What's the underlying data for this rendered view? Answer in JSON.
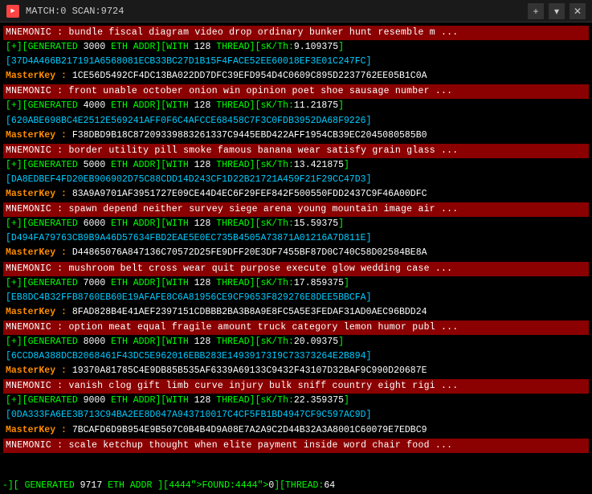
{
  "titleBar": {
    "icon": "►",
    "title": "MATCH:0 SCAN:9724",
    "closeBtn": "✕",
    "newTabBtn": "+",
    "dropdownBtn": "▾"
  },
  "blocks": [
    {
      "mnemonic": "MNEMONIC : bundle fiscal diagram video drop ordinary bunker hunt resemble m ...",
      "generated": "[+][GENERATED 3000 ETH ADDR][WITH 128 THREAD][sK/Th:9.109375]",
      "hash": "[37D4A466B217191A6568081ECB33BC27D1B15F4FACE52EE60018EF3E01C247FC]",
      "masterkey": "MasterKey :  1CE56D5492CF4DC13BA022DD7DFC39EFD954D4C0609C895D2237762EE05B1C0A"
    },
    {
      "mnemonic": "MNEMONIC : front unable october onion win opinion poet shoe sausage number ...",
      "generated": "[+][GENERATED 4000 ETH ADDR][WITH 128 THREAD][sK/Th:11.21875]",
      "hash": "[620ABE698BC4E2512E569241AFF0F6C4AFCCE68458C7F3C0FDB3952DA68F9226]",
      "masterkey": "MasterKey :  F38DBD9B18C87209339883261337C9445EBD422AFF1954CB39EC2045080585B0"
    },
    {
      "mnemonic": "MNEMONIC : border utility pill smoke famous banana wear satisfy grain glass ...",
      "generated": "[+][GENERATED 5000 ETH ADDR][WITH 128 THREAD][sK/Th:13.421875]",
      "hash": "[DA8EDBEF4FD20EB906902D75C88CDD14D243CF1D22B21721A459F21F29CC47D3]",
      "masterkey": "MasterKey :  83A9A9701AF3951727E09CE44D4EC6F29FEF842F500550FDD2437C9F46A00DFC"
    },
    {
      "mnemonic": "MNEMONIC : spawn depend neither survey siege arena young mountain image air ...",
      "generated": "[+][GENERATED 6000 ETH ADDR][WITH 128 THREAD][sK/Th:15.59375]",
      "hash": "[D494FA79763CB9B9A46D57634FBD2EAE5E0EC735B4505A73871A01216A7D811E]",
      "masterkey": "MasterKey :  D44865076A847136C70572D25FE9DFF20E3DF7455BF87D0C740C58D02584BE8A"
    },
    {
      "mnemonic": "MNEMONIC : mushroom belt cross wear quit purpose execute glow wedding case ...",
      "generated": "[+][GENERATED 7000 ETH ADDR][WITH 128 THREAD][sK/Th:17.859375]",
      "hash": "[EB8DC4B32FFB8760EB60E19AFAFE8C6A81956CE9CF9653F829276E8DEE5BBCFA]",
      "masterkey": "MasterKey :  8FAD828B4E41AEF2397151CDBBB2BA3B8A9E8FC5A5E3FEDAF31AD0AEC96BDD24"
    },
    {
      "mnemonic": "MNEMONIC : option meat equal fragile amount truck category lemon humor publ ...",
      "generated": "[+][GENERATED 8000 ETH ADDR][WITH 128 THREAD][sK/Th:20.09375]",
      "hash": "[6CCD8A388DCB2068461F43DC5E962016EBB283E14939173I9C73373264E2B894]",
      "masterkey": "MasterKey :  19370A81785C4E9DB85B535AF6339A69133C9432F43107D32BAF9C990D20687E"
    },
    {
      "mnemonic": "MNEMONIC : vanish clog gift limb curve injury bulk sniff country eight rigi ...",
      "generated": "[+][GENERATED 9000 ETH ADDR][WITH 128 THREAD][sK/Th:22.359375]",
      "hash": "[0DA333FA6EE3B713C94BA2EE8D047A943710017C4CF5FB1BD4947CF9C597AC9D]",
      "masterkey": "MasterKey :  7BCAFD6D9B954E9B507C0B4B4D9A08E7A2A9C2D44B32A3A8001C60079E7EDBC9"
    },
    {
      "mnemonic": "MNEMONIC : scale ketchup thought when elite payment inside word chair food ...",
      "generated": "",
      "hash": "",
      "masterkey": ""
    }
  ],
  "statusBar": {
    "text": "-][ GENERATED 9717 ETH ADDR ][FOUND:0][THREAD:64"
  }
}
